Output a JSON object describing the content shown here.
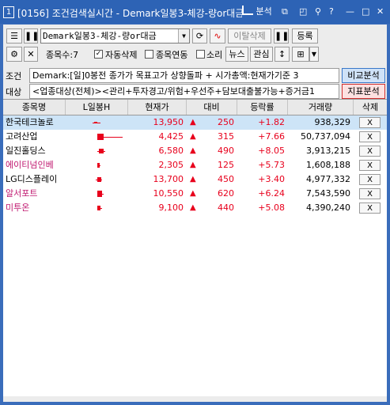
{
  "window": {
    "number": "1",
    "title": "[0156] 조건검색실시간 - Demark일봉3-체강-량or대금",
    "analysis_label": "분석",
    "buttons": [
      "⧉",
      "◰",
      "⚲",
      "?",
      "—",
      "□",
      "✕"
    ]
  },
  "toolbar": {
    "condition_name": "Demark일봉3-체강-량or대금",
    "deviation_delete": "이탈삭제",
    "register": "등록",
    "stock_count": "종목수:7",
    "auto_delete": "자동삭제",
    "stock_link": "종목연동",
    "sound": "소리",
    "news": "뉴스",
    "interest": "관심"
  },
  "condition": {
    "label": "조건",
    "text": "Demark:[일]0봉전 종가가 목표고가 상향돌파 + 시가총액:현재가기준 3",
    "compare_button": "비교분석"
  },
  "target": {
    "label": "대상",
    "text": "<업종대상(전체)><관리+투자경고/위험+우선주+담보대출불가능+증거금1",
    "indicator_button": "지표분석"
  },
  "table": {
    "headers": [
      "종목명",
      "L일봉H",
      "현재가",
      "대비",
      "등락률",
      "거래량",
      "삭제"
    ],
    "rows": [
      {
        "name": "한국테크놀로",
        "price": "13,950",
        "change": "250",
        "rate": "+1.82",
        "volume": "938,329",
        "del": "X",
        "name_color": "#000000",
        "selected": true
      },
      {
        "name": "고려산업",
        "price": "4,425",
        "change": "315",
        "rate": "+7.66",
        "volume": "50,737,094",
        "del": "X",
        "name_color": "#000000",
        "selected": false
      },
      {
        "name": "일진홀딩스",
        "price": "6,580",
        "change": "490",
        "rate": "+8.05",
        "volume": "3,913,215",
        "del": "X",
        "name_color": "#000000",
        "selected": false
      },
      {
        "name": "에이티넘인베",
        "price": "2,305",
        "change": "125",
        "rate": "+5.73",
        "volume": "1,608,188",
        "del": "X",
        "name_color": "#c01870",
        "selected": false
      },
      {
        "name": "LG디스플레이",
        "price": "13,700",
        "change": "450",
        "rate": "+3.40",
        "volume": "4,977,332",
        "del": "X",
        "name_color": "#000000",
        "selected": false
      },
      {
        "name": "알서포트",
        "price": "10,550",
        "change": "620",
        "rate": "+6.24",
        "volume": "7,543,590",
        "del": "X",
        "name_color": "#c01870",
        "selected": false
      },
      {
        "name": "미투온",
        "price": "9,100",
        "change": "440",
        "rate": "+5.08",
        "volume": "4,390,240",
        "del": "X",
        "name_color": "#c01870",
        "selected": false
      }
    ]
  },
  "colors": {
    "up": "#e8001c",
    "selected_row": "#cde4f7",
    "title_bar": "#2d63b5"
  }
}
